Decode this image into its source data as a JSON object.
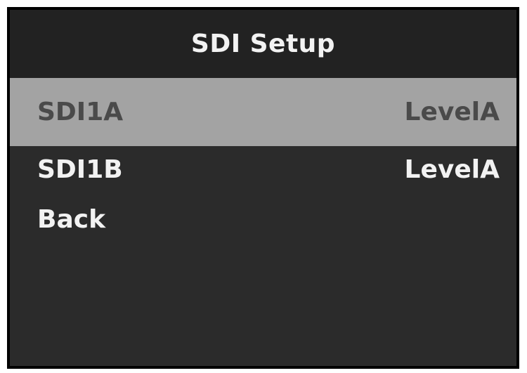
{
  "header": {
    "title": "SDI Setup"
  },
  "menu": {
    "items": [
      {
        "label": "SDI1A",
        "value": "LevelA",
        "selected": true
      },
      {
        "label": "SDI1B",
        "value": "LevelA",
        "selected": false
      },
      {
        "label": "Back",
        "value": "",
        "selected": false
      }
    ]
  },
  "colors": {
    "background": "#2b2b2b",
    "title_bar": "#222222",
    "selected_row": "#a3a3a3",
    "selected_text": "#4a4a4a",
    "text": "#f2f2f2"
  }
}
